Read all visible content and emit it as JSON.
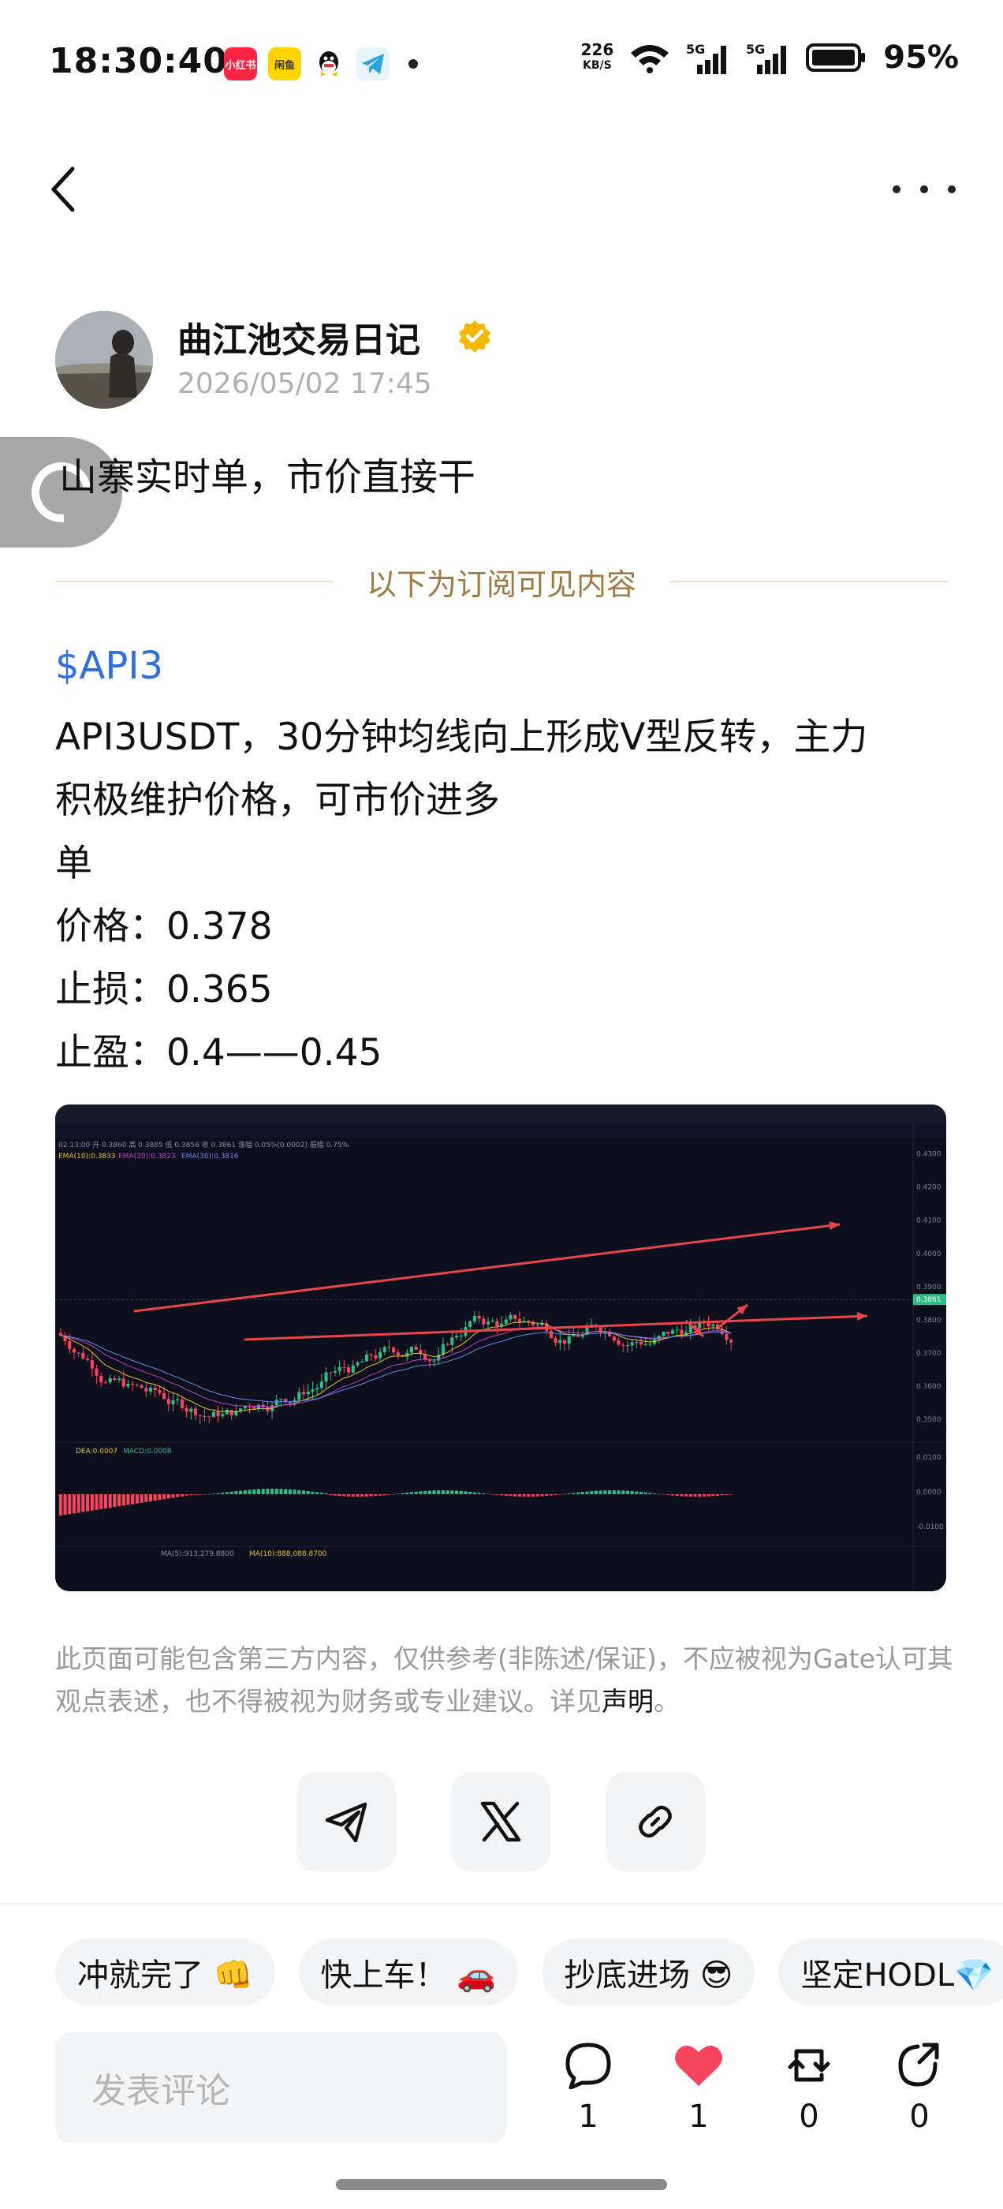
{
  "status_bar": {
    "time": "18:30:40",
    "apps": [
      {
        "label": "小红书",
        "color": "#ff2442"
      },
      {
        "label": "闲鱼",
        "color": "#ffd400"
      },
      {
        "label": "QQ",
        "color": "#222222"
      },
      {
        "label": "TG",
        "color": "#2aa3e0"
      }
    ],
    "net_speed": "226",
    "net_unit": "KB/S",
    "sim1": "5G",
    "sim2": "5G",
    "battery": "95%"
  },
  "header": {
    "back_icon": "chevron-left-icon",
    "more_icon": "more-dots-icon"
  },
  "author": {
    "name": "曲江池交易日记",
    "date": "2026/05/02 17:45",
    "verified_color": "#f5b800"
  },
  "post": {
    "title": "山寨实时单，市价直接干",
    "divider_text": "以下为订阅可见内容",
    "ticker": "$API3",
    "lines": [
      "API3USDT，30分钟均线向上形成V型反转，主力",
      "积极维护价格，可市价进多",
      "单",
      "价格：0.378",
      "止损：0.365",
      "止盈：0.4——0.45"
    ]
  },
  "chart_data": {
    "type": "candlestick",
    "symbol": "API3USDT",
    "timeframe": "30分",
    "ohlc_header": "02.13:00 开 0.3860 高 0.3885 低 0.3856 收 0.3861 涨幅 0.05%(0.0002) 振幅 0.75%",
    "ma_labels": [
      "EMA(10):0.3833",
      "EMA(20):0.3823",
      "EMA(30):0.3816"
    ],
    "macd_labels": [
      "DEA:0.0007",
      "MACD:0.0008"
    ],
    "volume_labels": [
      "MA(5):913,279.8800",
      "MA(10):888,088.8700"
    ],
    "y_ticks": [
      "0.4300",
      "0.4200",
      "0.4100",
      "0.4000",
      "0.3900",
      "0.3861",
      "0.3800",
      "0.3700",
      "0.3600",
      "0.3500"
    ],
    "macd_ticks": [
      "0.0100",
      "0.0000",
      "-0.0100"
    ],
    "last_price": 0.3861,
    "colors": {
      "up": "#2ebd85",
      "down": "#f6465d",
      "arrow": "#e8464a",
      "ema10": "#e6c229",
      "ema20": "#c03fc8",
      "ema30": "#5a8dee"
    }
  },
  "disclaimer": {
    "text": "此页面可能包含第三方内容，仅供参考(非陈述/保证)，不应被视为Gate认可其观点表述，也不得被视为财务或专业建议。详见",
    "link": "声明",
    "end": "。"
  },
  "share": [
    {
      "name": "share-telegram-button",
      "icon": "paper-plane-icon"
    },
    {
      "name": "share-x-button",
      "icon": "x-logo-icon"
    },
    {
      "name": "copy-link-button",
      "icon": "link-icon"
    }
  ],
  "chips": [
    "冲就完了 👊",
    "快上车！ 🚗",
    "抄底进场 😎",
    "坚定HODL💎"
  ],
  "comment": {
    "placeholder": "发表评论"
  },
  "actions": {
    "comment_count": "1",
    "like_count": "1",
    "repost_count": "0",
    "share_count": "0"
  }
}
